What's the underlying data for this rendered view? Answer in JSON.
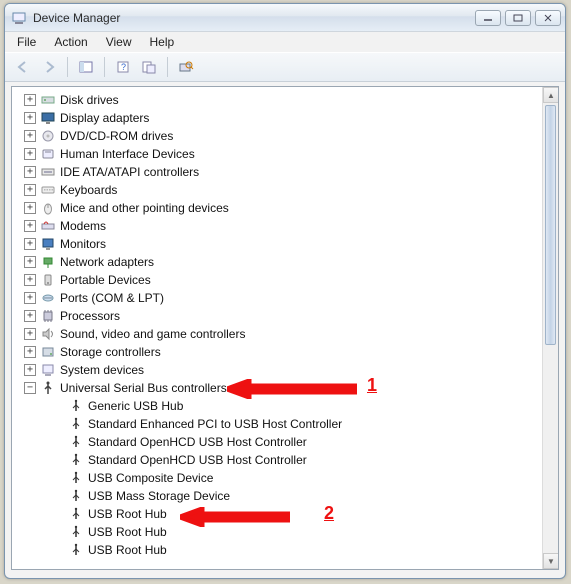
{
  "window": {
    "title": "Device Manager"
  },
  "menu": {
    "file": "File",
    "action": "Action",
    "view": "View",
    "help": "Help"
  },
  "tree": {
    "categories": [
      {
        "label": "Disk drives",
        "icon": "drive"
      },
      {
        "label": "Display adapters",
        "icon": "display"
      },
      {
        "label": "DVD/CD-ROM drives",
        "icon": "optical"
      },
      {
        "label": "Human Interface Devices",
        "icon": "hid"
      },
      {
        "label": "IDE ATA/ATAPI controllers",
        "icon": "ide"
      },
      {
        "label": "Keyboards",
        "icon": "keyboard"
      },
      {
        "label": "Mice and other pointing devices",
        "icon": "mouse"
      },
      {
        "label": "Modems",
        "icon": "modem"
      },
      {
        "label": "Monitors",
        "icon": "monitor"
      },
      {
        "label": "Network adapters",
        "icon": "network"
      },
      {
        "label": "Portable Devices",
        "icon": "portable"
      },
      {
        "label": "Ports (COM & LPT)",
        "icon": "port"
      },
      {
        "label": "Processors",
        "icon": "cpu"
      },
      {
        "label": "Sound, video and game controllers",
        "icon": "sound"
      },
      {
        "label": "Storage controllers",
        "icon": "storage"
      },
      {
        "label": "System devices",
        "icon": "system"
      }
    ],
    "usb": {
      "label": "Universal Serial Bus controllers",
      "children": [
        "Generic USB Hub",
        "Standard Enhanced PCI to USB Host Controller",
        "Standard OpenHCD USB Host Controller",
        "Standard OpenHCD USB Host Controller",
        "USB Composite Device",
        "USB Mass Storage Device",
        "USB Root Hub",
        "USB Root Hub",
        "USB Root Hub"
      ]
    }
  },
  "annotations": {
    "one": "1",
    "two": "2"
  }
}
